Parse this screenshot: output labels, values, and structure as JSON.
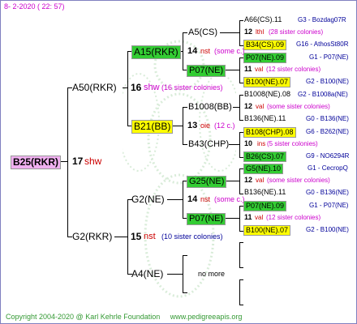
{
  "header": {
    "date": "8-  2-2020 ( 22: 57)"
  },
  "footer": {
    "copyright": "Copyright 2004-2020 @ Karl Kehrle Foundation",
    "url": "www.pedigreeapis.org"
  },
  "root": {
    "name": "B25(RKR)",
    "count": "17",
    "note": "shw"
  },
  "gen1": [
    {
      "name": "A50(RKR)",
      "count": "16",
      "note": "shw",
      "detail": "(16 sister colonies)"
    },
    {
      "name": "G2(RKR)",
      "count": "15",
      "note": "nst",
      "detail": "(10 sister colonies)"
    }
  ],
  "gen2": [
    {
      "name": "A15(RKR)",
      "count": "14",
      "note": "nst",
      "detail": "(some c.)"
    },
    {
      "name": "B21(BB)",
      "count": "13",
      "note": "oie",
      "detail": "(12 c.)"
    },
    {
      "name": "G2(NE)",
      "count": "14",
      "note": "nst",
      "detail": "(some c.)"
    },
    {
      "name": "A4(NE)",
      "more": "no more"
    }
  ],
  "gen3": [
    {
      "name": "A5(CS)"
    },
    {
      "name": "P07(NE)"
    },
    {
      "name": "B1008(BB)"
    },
    {
      "name": "B43(CHP)"
    },
    {
      "name": "G25(NE)"
    },
    {
      "name": "P07(NE)"
    }
  ],
  "gen4": [
    {
      "name": "A66(CS).11",
      "id": "G3 - Bozdag07R"
    },
    {
      "count": "12",
      "note": "lthl",
      "detail": "(28 sister colonies)"
    },
    {
      "name": "B34(CS).09",
      "id": "G16 - AthosSt80R"
    },
    {
      "name": "P07(NE).09",
      "id": "G1 - P07(NE)"
    },
    {
      "count": "11",
      "note": "val",
      "detail": "(12 sister colonies)"
    },
    {
      "name": "B100(NE).07",
      "id": "G2 - B100(NE)"
    },
    {
      "name": "B1008(NE).08",
      "id": "G2 - B1008a(NE)"
    },
    {
      "count": "12",
      "note": "val",
      "detail": "(some sister colonies)"
    },
    {
      "name": "B136(NE).11",
      "id": "G0 - B136(NE)"
    },
    {
      "name": "B108(CHP).08",
      "id": "G6 - B262(NE)"
    },
    {
      "count": "10",
      "note": "ins",
      "detail": "(5 sister colonies)"
    },
    {
      "name": "B26(CS).07",
      "id": "G9 - NO6294R"
    },
    {
      "name": "G5(NE).10",
      "id": "G1 - CecropQ"
    },
    {
      "count": "12",
      "note": "val",
      "detail": "(some sister colonies)"
    },
    {
      "name": "B136(NE).11",
      "id": "G0 - B136(NE)"
    },
    {
      "name": "P07(NE).09",
      "id": "G1 - P07(NE)"
    },
    {
      "count": "11",
      "note": "val",
      "detail": "(12 sister colonies)"
    },
    {
      "name": "B100(NE).07",
      "id": "G2 - B100(NE)"
    }
  ]
}
